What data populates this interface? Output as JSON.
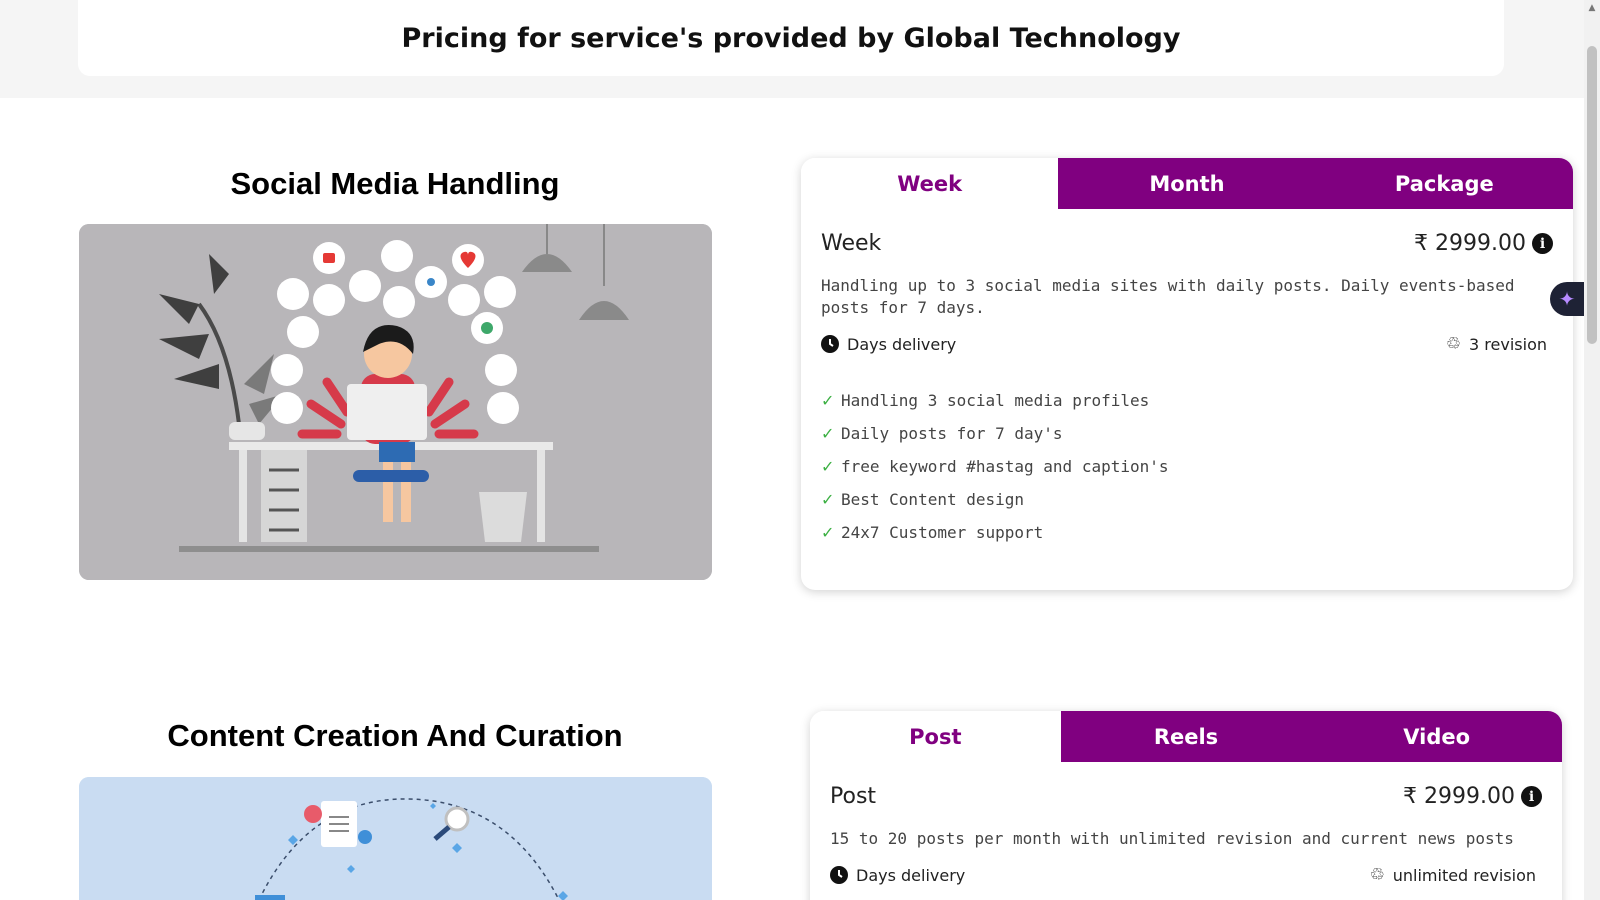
{
  "header": {
    "title": "Pricing for service's provided by Global Technology"
  },
  "sections": [
    {
      "title": "Social Media Handling",
      "card": {
        "tabs": [
          "Week",
          "Month",
          "Package"
        ],
        "active_tab": "Week",
        "plan_name": "Week",
        "price": "₹ 2999.00",
        "description": "Handling up to 3 social media sites with daily posts. Daily events-based posts for 7 days.",
        "delivery": "Days delivery",
        "revision": "3 revision",
        "features": [
          "Handling 3 social media profiles",
          "Daily posts for 7 day's",
          "free keyword #hastag and caption's",
          "Best Content design",
          "24x7 Customer support"
        ]
      }
    },
    {
      "title": "Content Creation And Curation",
      "card": {
        "tabs": [
          "Post",
          "Reels",
          "Video"
        ],
        "active_tab": "Post",
        "plan_name": "Post",
        "price": "₹ 2999.00",
        "description": "15 to 20 posts per month with unlimited revision and current news posts",
        "delivery": "Days delivery",
        "revision": "unlimited revision"
      }
    }
  ],
  "colors": {
    "brand_purple": "#800080",
    "check_green": "#3cb043",
    "illustration_bg_1": "#b8b6b9",
    "illustration_bg_2": "#c9dcf2"
  },
  "icons": [
    "info-icon",
    "clock-icon",
    "recycle-icon",
    "check-icon",
    "sparkle-icon"
  ]
}
